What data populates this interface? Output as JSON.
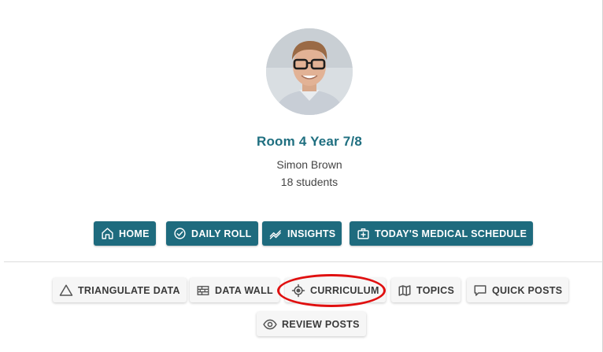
{
  "class_card": {
    "title": "Room 4 Year 7/8",
    "teacher": "Simon Brown",
    "student_count": "18 students"
  },
  "primary_actions": [
    {
      "label": "HOME",
      "icon": "home-icon"
    },
    {
      "label": "DAILY ROLL",
      "icon": "check-circle-icon"
    },
    {
      "label": "INSIGHTS",
      "icon": "trending-icon"
    },
    {
      "label": "TODAY'S MEDICAL SCHEDULE",
      "icon": "medical-bag-icon"
    }
  ],
  "secondary_actions": [
    {
      "label": "TRIANGULATE DATA",
      "icon": "triangle-icon"
    },
    {
      "label": "DATA WALL",
      "icon": "brick-wall-icon"
    },
    {
      "label": "CURRICULUM",
      "icon": "target-icon",
      "highlighted": true
    },
    {
      "label": "TOPICS",
      "icon": "map-icon"
    },
    {
      "label": "QUICK POSTS",
      "icon": "comment-icon"
    },
    {
      "label": "REVIEW POSTS",
      "icon": "eye-icon"
    }
  ],
  "colors": {
    "primary_button": "#1e6b7e",
    "title": "#1f6f80",
    "highlight_ring": "#e01010"
  }
}
